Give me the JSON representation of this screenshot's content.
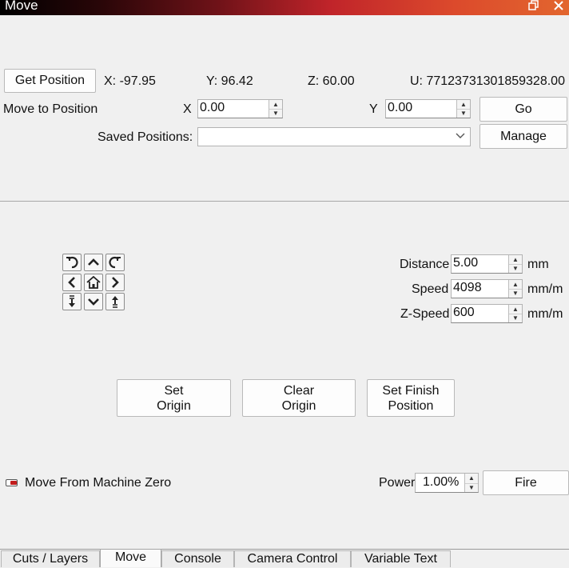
{
  "window": {
    "title": "Move",
    "restore_icon": "restore-window-icon",
    "close_icon": "close-icon"
  },
  "position": {
    "get_position_label": "Get Position",
    "x_readout": "X: -97.95",
    "y_readout": "Y: 96.42",
    "z_readout": "Z: 60.00",
    "u_readout": "U: 77123731301859328.00"
  },
  "move_to": {
    "label": "Move to Position",
    "x_label": "X",
    "x_value": "0.00",
    "y_label": "Y",
    "y_value": "0.00",
    "go_label": "Go"
  },
  "saved": {
    "label": "Saved Positions:",
    "value": "",
    "manage_label": "Manage"
  },
  "jog": {
    "icons": [
      "rotate-ccw-icon",
      "arrow-up-icon",
      "rotate-cw-icon",
      "arrow-left-icon",
      "home-icon",
      "arrow-right-icon",
      "z-down-icon",
      "arrow-down-icon",
      "z-up-icon"
    ]
  },
  "settings": {
    "distance_label": "Distance",
    "distance_value": "5.00",
    "distance_unit": "mm",
    "speed_label": "Speed",
    "speed_value": "4098",
    "speed_unit": "mm/m",
    "zspeed_label": "Z-Speed",
    "zspeed_value": "600",
    "zspeed_unit": "mm/m"
  },
  "origin": {
    "set_origin_l1": "Set",
    "set_origin_l2": "Origin",
    "clear_origin_l1": "Clear",
    "clear_origin_l2": "Origin",
    "set_finish_l1": "Set Finish",
    "set_finish_l2": "Position"
  },
  "fire": {
    "move_from_zero_label": "Move From Machine Zero",
    "power_label": "Power",
    "power_value": "1.00%",
    "fire_label": "Fire"
  },
  "tabs": [
    {
      "label": "Cuts / Layers"
    },
    {
      "label": "Move"
    },
    {
      "label": "Console"
    },
    {
      "label": "Camera Control"
    },
    {
      "label": "Variable Text"
    }
  ],
  "colors": {
    "toggle_active": "#c21c1c",
    "titlebar_start": "#000000",
    "titlebar_end": "#e2662e"
  }
}
